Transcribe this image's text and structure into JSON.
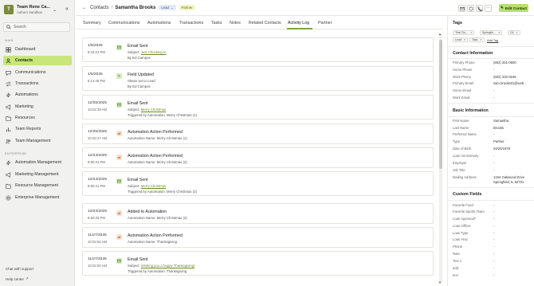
{
  "sidebar": {
    "team_avatar": "T",
    "team_name": "Team Rene Ca...",
    "team_sub": "Auburn Sandbox",
    "search_placeholder": "Search",
    "section_main": "MAIN",
    "items": [
      {
        "label": "Dashboard",
        "icon": "dashboard-icon"
      },
      {
        "label": "Contacts",
        "icon": "contacts-icon"
      },
      {
        "label": "Communications",
        "icon": "communications-icon"
      },
      {
        "label": "Transactions",
        "icon": "transactions-icon"
      },
      {
        "label": "Automations",
        "icon": "automations-icon"
      },
      {
        "label": "Marketing",
        "icon": "marketing-icon"
      },
      {
        "label": "Resources",
        "icon": "resources-icon"
      },
      {
        "label": "Team Reports",
        "icon": "team-reports-icon"
      },
      {
        "label": "Team Management",
        "icon": "team-management-icon"
      }
    ],
    "section_enterprise": "ENTERPRISE",
    "enterprise_items": [
      {
        "label": "Automation Management",
        "icon": "automation-management-icon"
      },
      {
        "label": "Marketing Management",
        "icon": "marketing-management-icon"
      },
      {
        "label": "Resource Management",
        "icon": "resource-management-icon"
      },
      {
        "label": "Enterprise Management",
        "icon": "enterprise-management-icon"
      }
    ],
    "chat_support": "Chat with support",
    "help_center": "Help center"
  },
  "header": {
    "crumb_root": "Contacts",
    "crumb_sep": "/",
    "contact_name": "Samantha Brooks",
    "status_badge": "Lead",
    "type_badge": "Partner",
    "edit_button": "Edit Contact"
  },
  "tabs": [
    "Summary",
    "Communications",
    "Automations",
    "Transactions",
    "Tasks",
    "Notes",
    "Related Contacts",
    "Activity Log",
    "Partner"
  ],
  "activity": [
    {
      "date": "1/5/2026",
      "time": "8:16:23 PM",
      "icon": "email-icon",
      "tone": "green",
      "title": "Email Sent",
      "l1_prefix": "Subject: ",
      "l1_link": "Just Checking In",
      "l2": "By Ed Campos"
    },
    {
      "date": "1/5/2026",
      "time": "8:12:48 PM",
      "icon": "edit-icon",
      "tone": "green",
      "title": "Field Updated",
      "l1_prefix": "Status set to Lead",
      "l1_link": "",
      "l2": "By Ed Campos"
    },
    {
      "date": "12/25/2025",
      "time": "10:02:28 AM",
      "icon": "email-icon",
      "tone": "green",
      "title": "Email Sent",
      "l1_prefix": "Subject: ",
      "l1_link": "Merry Christmas",
      "l2": "Triggered by Automation: Merry Christmas (1)"
    },
    {
      "date": "12/25/2025",
      "time": "10:02:27 AM",
      "icon": "automation-icon",
      "tone": "orange",
      "title": "Automation Action Performed",
      "l1_prefix": "Automation Name: Merry Christmas (1)",
      "l1_link": "",
      "l2": ""
    },
    {
      "date": "12/24/2025",
      "time": "8:50:43 PM",
      "icon": "automation-icon",
      "tone": "orange",
      "title": "Automation Action Performed",
      "l1_prefix": "Automation Name: Merry Christmas (2)",
      "l1_link": "",
      "l2": ""
    },
    {
      "date": "12/24/2025",
      "time": "8:50:41 PM",
      "icon": "email-icon",
      "tone": "green",
      "title": "Email Sent",
      "l1_prefix": "Subject: ",
      "l1_link": "Merry Christmas",
      "l2": "Triggered by Automation: Merry Christmas (2)"
    },
    {
      "date": "12/24/2025",
      "time": "8:50:36 PM",
      "icon": "automation-icon",
      "tone": "orange",
      "title": "Added to Automation",
      "l1_prefix": "Automation Name: Merry Christmas (2)",
      "l1_link": "",
      "l2": ""
    },
    {
      "date": "11/27/2025",
      "time": "10:02:52 AM",
      "icon": "automation-icon",
      "tone": "orange",
      "title": "Automation Action Performed",
      "l1_prefix": "Automation Name: Thanksgiving",
      "l1_link": "",
      "l2": ""
    },
    {
      "date": "11/27/2025",
      "time": "10:02:00 AM",
      "icon": "email-icon",
      "tone": "green",
      "title": "Email Sent",
      "l1_prefix": "Subject: ",
      "l1_link": "Wishing you a happy Thanksgiving!",
      "l2": "Triggered by Automation: Thanksgiving"
    }
  ],
  "right": {
    "tags_heading": "Tags",
    "tags": [
      "Trial Clo...",
      "Springfie...",
      "Gli",
      "Lead",
      "Task"
    ],
    "add_tag": "Add Tag",
    "contact_info_heading": "Contact Information",
    "contact_rows": [
      {
        "label": "Primary Phone",
        "value": "(803) 331-0500"
      },
      {
        "label": "Home Phone",
        "value": "-"
      },
      {
        "label": "Work Phone",
        "value": "(803) 332-9245"
      },
      {
        "label": "Primary Email",
        "value": "sam.brooks01@web..."
      },
      {
        "label": "Home Email",
        "value": "-"
      },
      {
        "label": "Work Email",
        "value": "-"
      }
    ],
    "basic_info_heading": "Basic Information",
    "basic_rows": [
      {
        "label": "First Name",
        "value": "Samantha"
      },
      {
        "label": "Last Name",
        "value": "Brooks"
      },
      {
        "label": "Preferred Name",
        "value": "-"
      },
      {
        "label": "Type",
        "value": "Partner"
      },
      {
        "label": "Date of Birth",
        "value": "04/20/1979"
      },
      {
        "label": "Loan Anniversary",
        "value": "-"
      },
      {
        "label": "Employer",
        "value": "-"
      },
      {
        "label": "Job Title",
        "value": "-"
      }
    ],
    "mailing_label": "Mailing Address",
    "mailing_line1": "1234 Oakwood Drive",
    "mailing_line2": "Springfield, IL 62701",
    "custom_heading": "Custom Fields",
    "custom_rows": [
      {
        "label": "Favorite Food",
        "value": "-"
      },
      {
        "label": "Favorite Sports Team",
        "value": "-"
      },
      {
        "label": "Loan Approval?",
        "value": "-"
      },
      {
        "label": "Loan Officer",
        "value": "-"
      },
      {
        "label": "Loan Type",
        "value": "-"
      },
      {
        "label": "Loan Year",
        "value": "-"
      },
      {
        "label": "Phone",
        "value": "-"
      },
      {
        "label": "Rate",
        "value": "-"
      },
      {
        "label": "Text 1",
        "value": "-"
      },
      {
        "label": "add",
        "value": "-"
      },
      {
        "label": "text",
        "value": "-"
      }
    ]
  },
  "colors": {
    "accent": "#c9e67a",
    "button": "#b8e06a",
    "link": "#6a8a1e"
  }
}
